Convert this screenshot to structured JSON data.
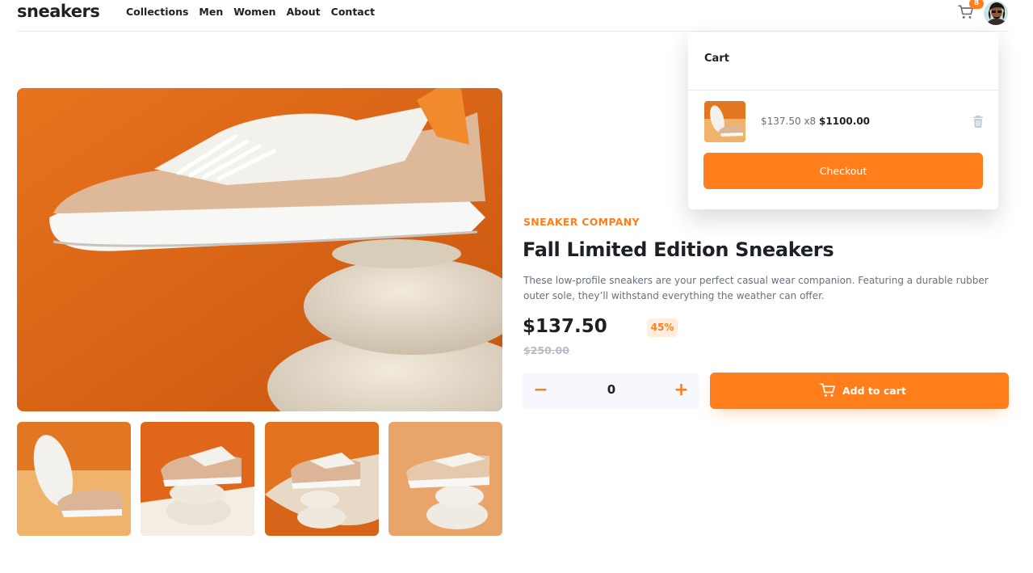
{
  "header": {
    "logo": "sneakers",
    "nav": [
      "Collections",
      "Men",
      "Women",
      "About",
      "Contact"
    ],
    "cart_count": "8"
  },
  "product": {
    "company": "SNEAKER COMPANY",
    "title": "Fall Limited Edition Sneakers",
    "description": "These low-profile sneakers are your perfect casual wear companion. Featuring a durable rubber outer sole, they’ll withstand everything the weather can offer.",
    "price": "$137.50",
    "discount": "45%",
    "old_price": "$250.00",
    "quantity": "0",
    "qty_minus": "−",
    "qty_plus": "+",
    "add_to_cart_label": "Add to cart"
  },
  "cart": {
    "title": "Cart",
    "item_unit": "$137.50 x8",
    "item_total": "$1100.00",
    "checkout_label": "Checkout"
  },
  "colors": {
    "accent": "#ff7e1b",
    "accent_pale": "#ffede0",
    "dark": "#1d2025",
    "gray": "#68707d",
    "light_gray": "#b6bcc8"
  },
  "icons": {
    "cart": "cart-icon",
    "trash": "trash-icon",
    "avatar": "avatar"
  }
}
